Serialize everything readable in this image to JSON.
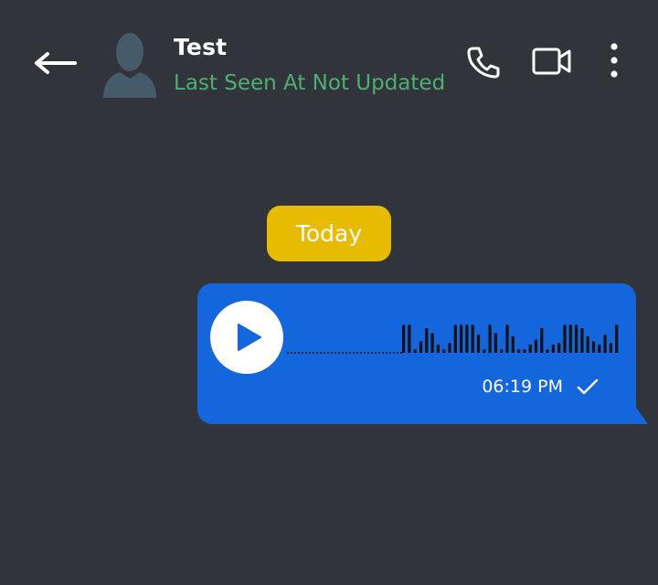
{
  "header": {
    "contact_name": "Test",
    "status": "Last Seen At Not Updated",
    "status_color": "#4fae72",
    "back_icon": "back-arrow-icon",
    "avatar_icon": "default-avatar-icon",
    "actions": [
      "phone-icon",
      "video-camera-icon",
      "more-vert-icon"
    ]
  },
  "chat": {
    "date_label": "Today",
    "date_chip_color": "#e7bb00",
    "messages": [
      {
        "type": "voice",
        "direction": "outgoing",
        "time": "06:19 PM",
        "status_icon": "single-check-icon",
        "bubble_color": "#1466dc",
        "waveform": [
          0.85,
          0.85,
          0.1,
          0.35,
          0.75,
          0.6,
          0.25,
          0.1,
          0.3,
          0.85,
          0.85,
          0.85,
          0.85,
          0.55,
          0.1,
          0.85,
          0.6,
          0.1,
          0.85,
          0.5,
          0.1,
          0.1,
          0.25,
          0.4,
          0.75,
          0.1,
          0.25,
          0.3,
          0.85,
          0.85,
          0.85,
          0.75,
          0.5,
          0.35,
          0.25,
          0.55,
          0.3,
          0.85
        ]
      }
    ]
  },
  "colors": {
    "background": "#31343b",
    "waveform": "#111111"
  }
}
